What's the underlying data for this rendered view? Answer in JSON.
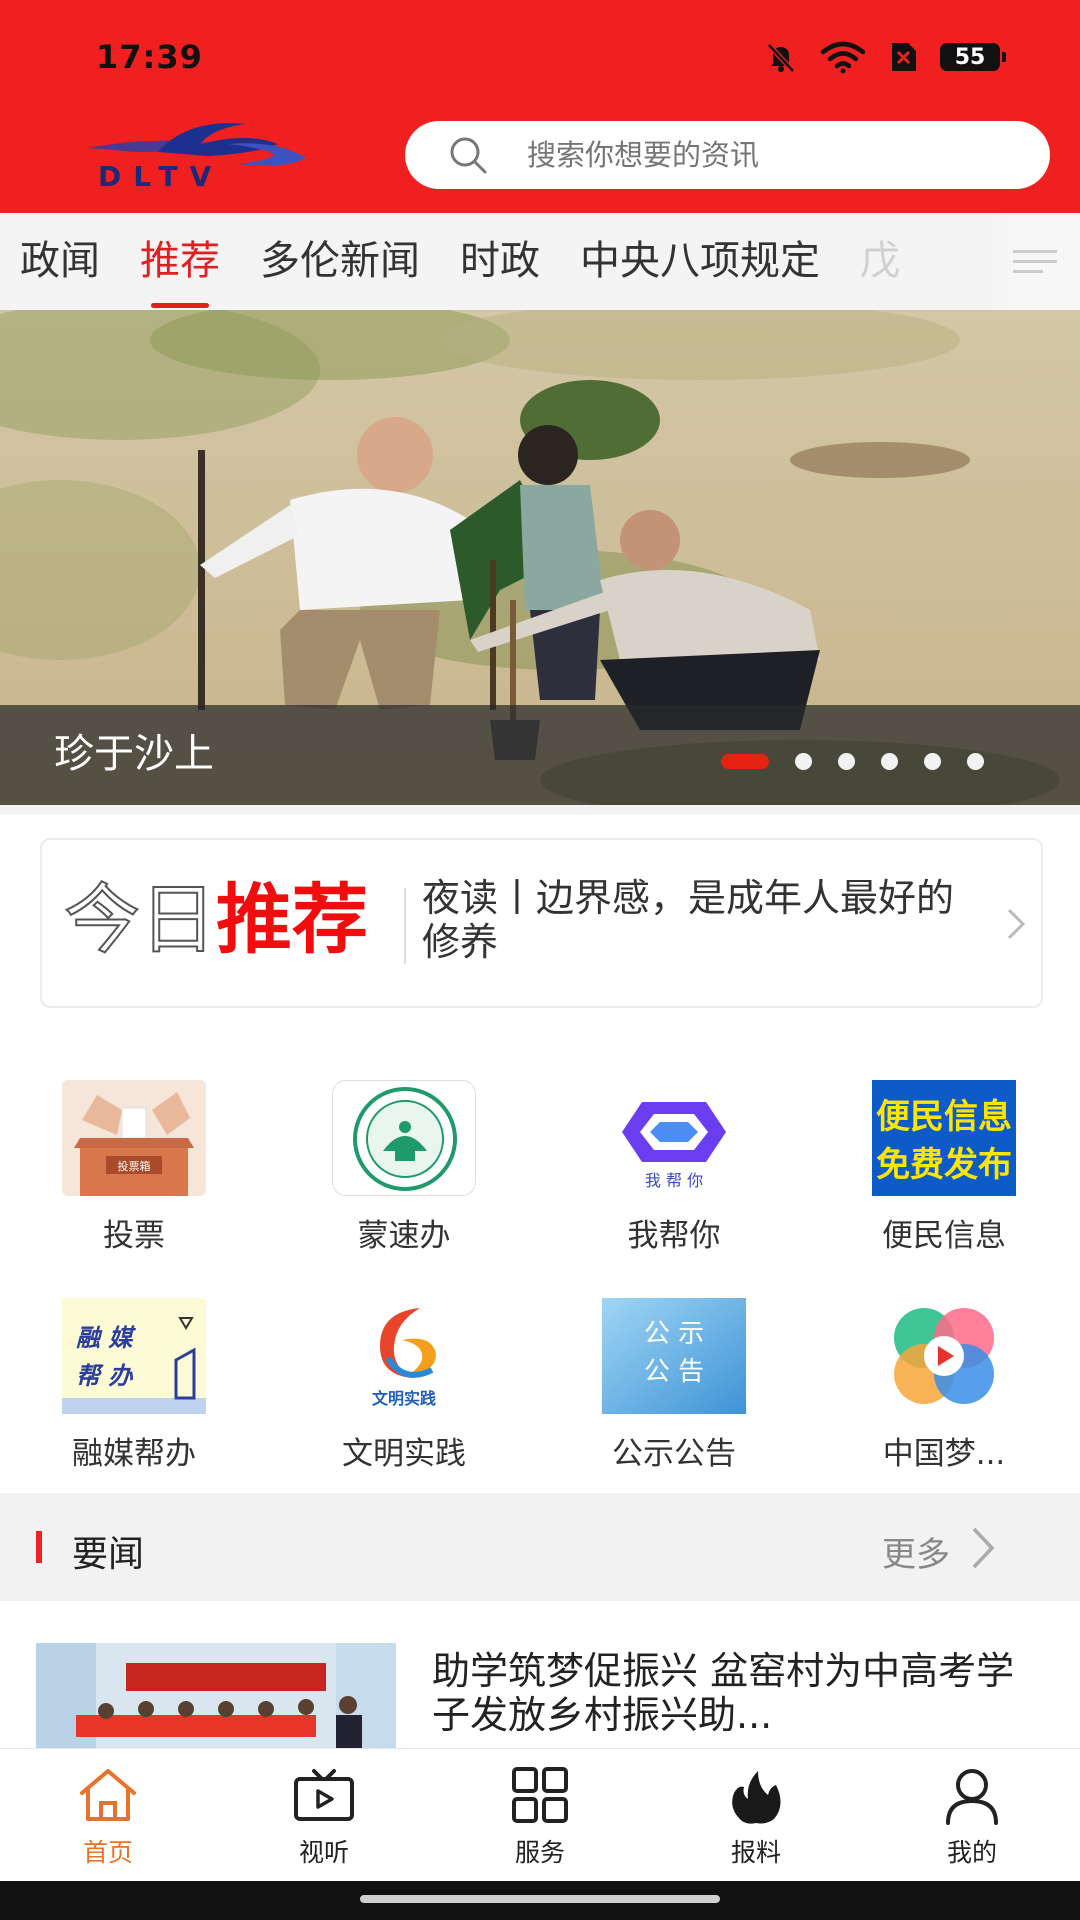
{
  "status_bar": {
    "time": "17:39",
    "battery": "55"
  },
  "header": {
    "logo_text": "DLTV",
    "search": {
      "placeholder": "搜索你想要的资讯"
    }
  },
  "tabs": [
    {
      "label": "政闻"
    },
    {
      "label": "推荐"
    },
    {
      "label": "多伦新闻"
    },
    {
      "label": "时政"
    },
    {
      "label": "中央八项规定"
    },
    {
      "label": "戊"
    }
  ],
  "active_tab": "推荐",
  "banner": {
    "caption": "珍于沙上",
    "slide_count": 6,
    "active_slide": 1
  },
  "today": {
    "label_outline": "今日",
    "label_red": "推荐",
    "headline": "夜读丨边界感，是成年人最好的修养"
  },
  "services": [
    {
      "label": "投票",
      "icon": "ballot-box-icon",
      "icon_text": "投票箱"
    },
    {
      "label": "蒙速办",
      "icon": "mengsuban-icon"
    },
    {
      "label": "我帮你",
      "icon": "help-you-icon",
      "icon_text": "我 帮 你"
    },
    {
      "label": "便民信息",
      "icon": "civil-info-icon",
      "icon_text_1": "便民信息",
      "icon_text_2": "免费发布"
    },
    {
      "label": "融媒帮办",
      "icon": "media-help-icon",
      "icon_text_1": "融  媒",
      "icon_text_2": "帮  办"
    },
    {
      "label": "文明实践",
      "icon": "civilization-practice-icon",
      "icon_text": "文明实践"
    },
    {
      "label": "公示公告",
      "icon": "notice-icon",
      "icon_text_1": "公  示",
      "icon_text_2": "公  告"
    },
    {
      "label": "中国梦...",
      "icon": "china-dream-icon"
    }
  ],
  "news_section": {
    "title": "要闻",
    "more_label": "更多",
    "items": [
      {
        "title": "助学筑梦促振兴 盆窑村为中高考学子发放乡村振兴助..."
      }
    ]
  },
  "bottom_nav": [
    {
      "label": "首页",
      "icon": "home-icon"
    },
    {
      "label": "视听",
      "icon": "tv-play-icon"
    },
    {
      "label": "服务",
      "icon": "grid-icon"
    },
    {
      "label": "报料",
      "icon": "flame-icon"
    },
    {
      "label": "我的",
      "icon": "user-icon"
    }
  ],
  "colors": {
    "brand_red": "#f12020",
    "active_nav": "#e8722c",
    "tab_active": "#e02020"
  }
}
